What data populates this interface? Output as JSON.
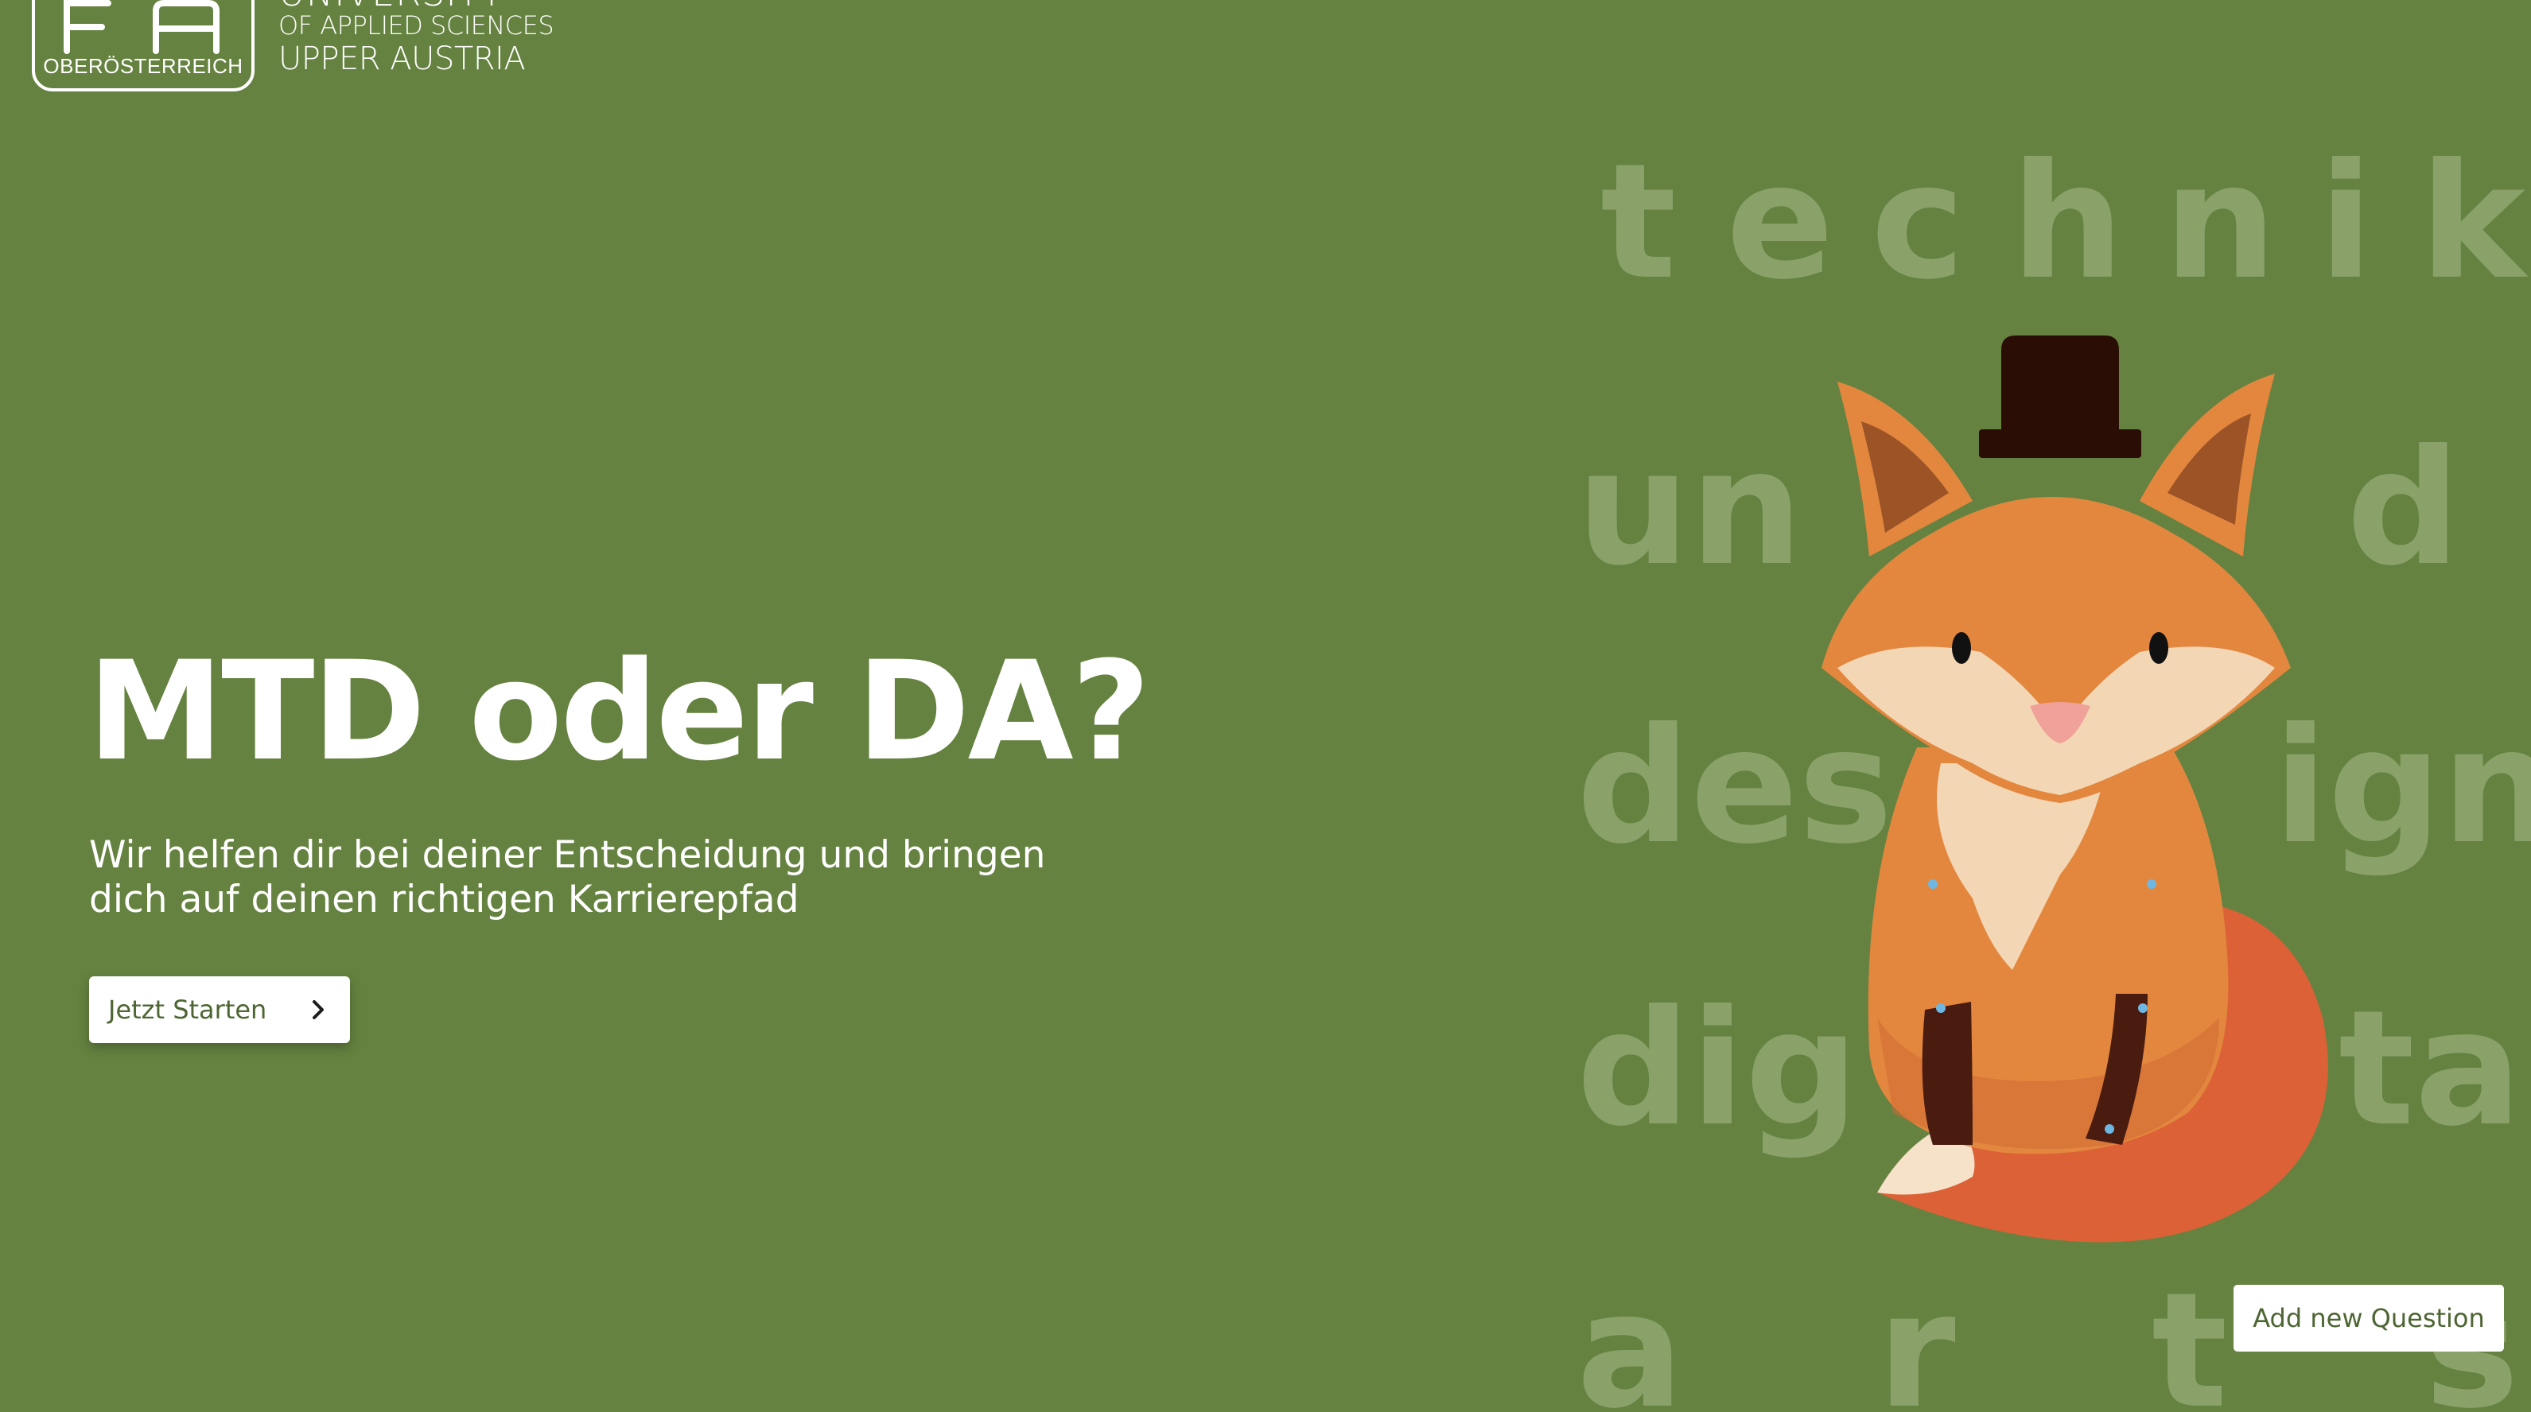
{
  "brand": {
    "logo_sub": "OBERÖSTERREICH",
    "name_line1": "UNIVERSITY",
    "name_line2": "OF APPLIED SCIENCES",
    "name_line3": "UPPER AUSTRIA"
  },
  "hero": {
    "title": "MTD oder DA?",
    "subtitle": "Wir helfen dir bei deiner Entscheidung und bringen dich auf deinen richtigen Karrierepfad",
    "start_label": "Jetzt Starten"
  },
  "background_letters": {
    "technik": [
      "t",
      "e",
      "c",
      "h",
      "n",
      "i",
      "k"
    ],
    "und_left": "un",
    "und_right": "d",
    "design_left": "des",
    "design_right": "ign",
    "digital_left": "dig",
    "digital_right": "tal",
    "arts": [
      "a",
      "r",
      "t",
      "s"
    ]
  },
  "actions": {
    "add_question_label": "Add new Question"
  },
  "colors": {
    "background": "#658240",
    "letters": "#8aa26a",
    "button_text": "#4d6532",
    "fox_orange": "#e3873f",
    "fox_tail": "#dc6136",
    "fox_cream": "#f3d7b5",
    "hat": "#2a0e05"
  },
  "icons": {
    "start_chevron": "chevron-right-icon",
    "mascot": "fox-mascot"
  }
}
